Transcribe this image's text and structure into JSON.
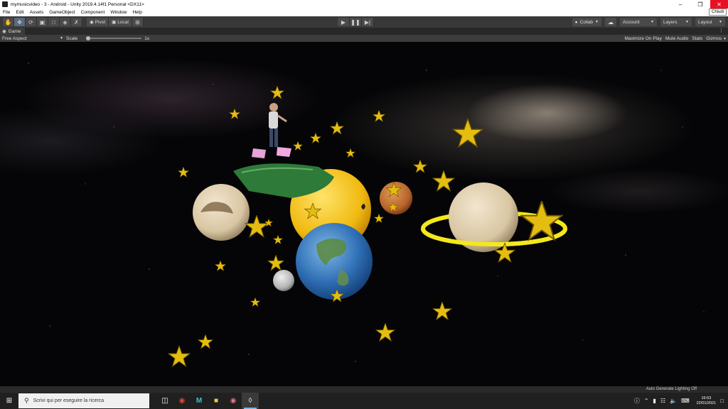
{
  "window": {
    "title": "mymusicvideo - 3 - Android - Unity 2019.4.14f1 Personal <DX11>",
    "tooltip": "Chiudi"
  },
  "menu": [
    "File",
    "Edit",
    "Assets",
    "GameObject",
    "Component",
    "Window",
    "Help"
  ],
  "toolbar": {
    "pivot_label": "Pivot",
    "local_label": "Local",
    "collab_label": "Collab",
    "account_label": "Account",
    "layers_label": "Layers",
    "layout_label": "Layout"
  },
  "game_tab": {
    "label": "Game",
    "aspect": "Free Aspect",
    "scale_label": "Scale",
    "scale_value": "1x",
    "scale_fraction": 0.0,
    "options": [
      "Maximize On Play",
      "Mute Audio",
      "Stats",
      "Gizmos"
    ]
  },
  "status": {
    "text": "Auto Generate Lighting Off"
  },
  "taskbar": {
    "search_placeholder": "Scrivi qui per eseguire la ricerca",
    "time": "16:53",
    "date": "22/01/2021"
  },
  "colors": {
    "accent_close": "#e81123",
    "editor_dark": "#383838",
    "sun_yellow": "#f2c21a",
    "star_gold": "#e8c20e"
  },
  "icons": {
    "hand": "hand-tool-icon",
    "move": "move-tool-icon",
    "rotate": "rotate-tool-icon",
    "scale": "scale-tool-icon",
    "rect": "rect-tool-icon",
    "transform": "transform-tool-icon",
    "custom": "custom-tool-icon"
  }
}
